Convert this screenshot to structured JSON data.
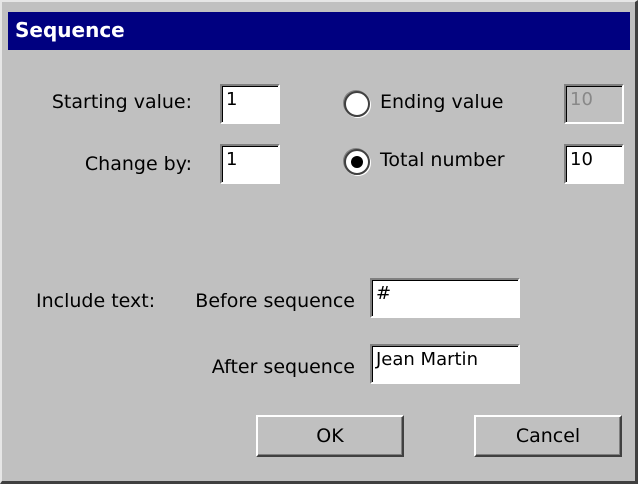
{
  "window": {
    "title": "Sequence"
  },
  "labels": {
    "starting_value": "Starting value:",
    "change_by": "Change by:",
    "ending_value": "Ending value",
    "total_number": "Total number",
    "include_text": "Include text:",
    "before_sequence": "Before sequence",
    "after_sequence": "After sequence"
  },
  "fields": {
    "starting_value": "1",
    "change_by": "1",
    "ending_value": "10",
    "total_number": "10",
    "before_sequence": "#",
    "after_sequence": "Jean Martin"
  },
  "radios": {
    "ending_value_selected": false,
    "total_number_selected": true
  },
  "buttons": {
    "ok": "OK",
    "cancel": "Cancel"
  }
}
